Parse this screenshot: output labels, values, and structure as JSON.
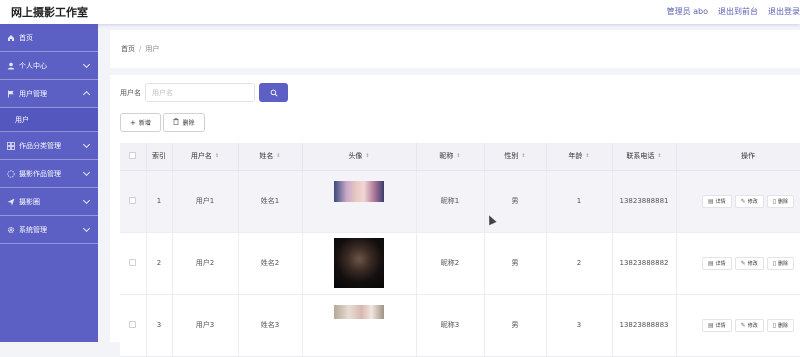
{
  "app": {
    "title": "网上摄影工作室",
    "topnav": [
      "管理员 abo",
      "退出到前台",
      "退出登录"
    ]
  },
  "sidebar": {
    "items": [
      {
        "label": "首页",
        "icon": "home-icon",
        "expandable": false
      },
      {
        "label": "个人中心",
        "icon": "user-icon",
        "expandable": true
      },
      {
        "label": "用户管理",
        "icon": "flag-icon",
        "expandable": true,
        "expanded": true,
        "children": [
          "用户"
        ]
      },
      {
        "label": "作品分类管理",
        "icon": "grid-icon",
        "expandable": true
      },
      {
        "label": "摄影作品管理",
        "icon": "circle-icon",
        "expandable": true
      },
      {
        "label": "摄影圈",
        "icon": "send-icon",
        "expandable": true
      },
      {
        "label": "系统管理",
        "icon": "gear-icon",
        "expandable": true
      }
    ]
  },
  "breadcrumb": {
    "home": "首页",
    "separator": "/",
    "current": "用户"
  },
  "search": {
    "label": "用户名",
    "placeholder": "用户名",
    "value": ""
  },
  "toolbar": {
    "add_label": "新增",
    "delete_label": "删除"
  },
  "table": {
    "columns": [
      "索引",
      "用户名",
      "姓名",
      "头像",
      "昵称",
      "性别",
      "年龄",
      "联系电话",
      "操作"
    ],
    "rows": [
      {
        "index": "1",
        "username": "用户1",
        "name": "姓名1",
        "nickname": "昵称1",
        "gender": "男",
        "age": "1",
        "phone": "13823888881"
      },
      {
        "index": "2",
        "username": "用户2",
        "name": "姓名2",
        "nickname": "昵称2",
        "gender": "男",
        "age": "2",
        "phone": "13823888882"
      },
      {
        "index": "3",
        "username": "用户3",
        "name": "姓名3",
        "nickname": "昵称3",
        "gender": "男",
        "age": "3",
        "phone": "13823888883"
      }
    ],
    "actions": {
      "detail": "详情",
      "edit": "修改",
      "delete": "删除"
    }
  },
  "colors": {
    "accent": "#5c5fc4",
    "sidebar_bg": "#5c5fc4",
    "page_bg": "#f3f4f8"
  }
}
